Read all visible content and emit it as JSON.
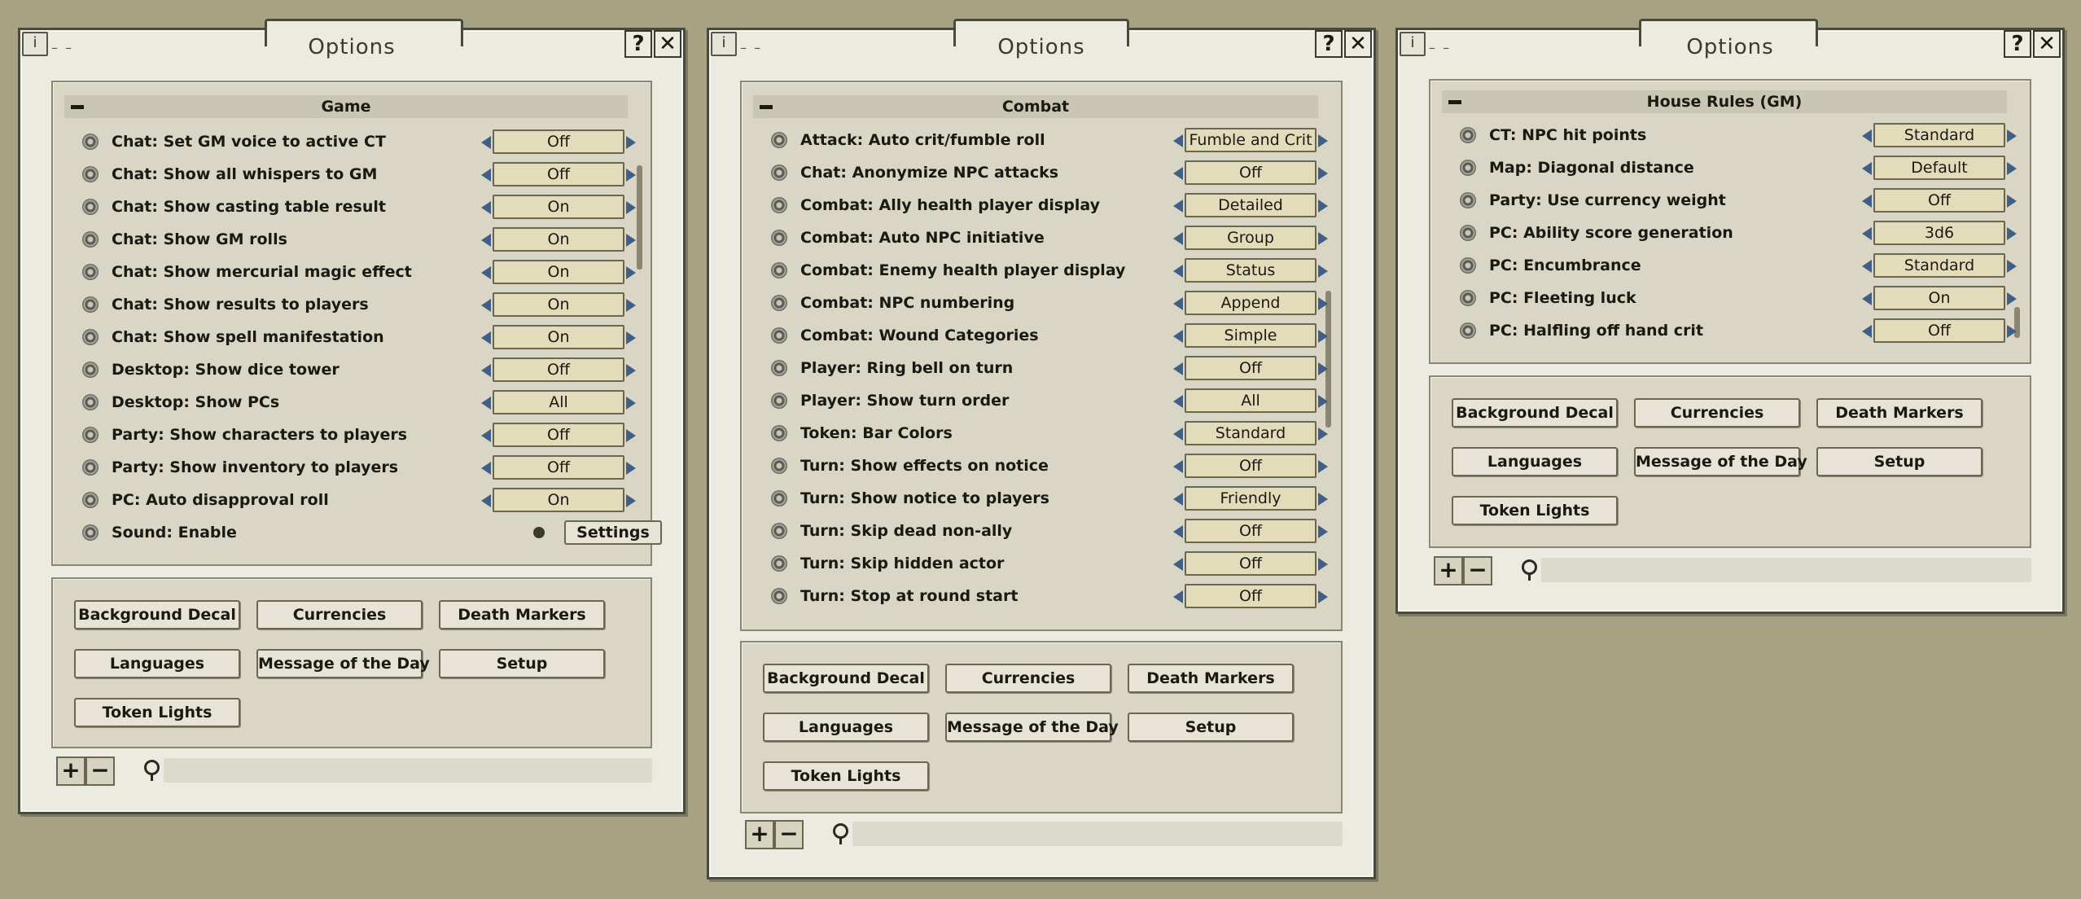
{
  "colors": {
    "background": "#a8a284",
    "arrow": "#3f5f86",
    "value_box": "#e3dcbb"
  },
  "windows": [
    {
      "title": "Options",
      "section": "Game",
      "rows": [
        {
          "label": "Chat: Set GM voice to active CT",
          "value": "Off"
        },
        {
          "label": "Chat: Show all whispers to GM",
          "value": "Off"
        },
        {
          "label": "Chat: Show casting table result",
          "value": "On"
        },
        {
          "label": "Chat: Show GM rolls",
          "value": "On"
        },
        {
          "label": "Chat: Show mercurial magic effect",
          "value": "On"
        },
        {
          "label": "Chat: Show results to players",
          "value": "On"
        },
        {
          "label": "Chat: Show spell manifestation",
          "value": "On"
        },
        {
          "label": "Desktop: Show dice tower",
          "value": "Off"
        },
        {
          "label": "Desktop: Show PCs",
          "value": "All"
        },
        {
          "label": "Party: Show characters to players",
          "value": "Off"
        },
        {
          "label": "Party: Show inventory to players",
          "value": "Off"
        },
        {
          "label": "PC: Auto disapproval roll",
          "value": "On"
        }
      ],
      "sound_row": {
        "label": "Sound: Enable",
        "button": "Settings"
      },
      "buttons": [
        "Background Decal",
        "Currencies",
        "Death Markers",
        "Languages",
        "Message of the Day",
        "Setup",
        "Token Lights"
      ]
    },
    {
      "title": "Options",
      "section": "Combat",
      "rows": [
        {
          "label": "Attack: Auto crit/fumble roll",
          "value": "Fumble and Crit"
        },
        {
          "label": "Chat: Anonymize NPC attacks",
          "value": "Off"
        },
        {
          "label": "Combat: Ally health player display",
          "value": "Detailed"
        },
        {
          "label": "Combat: Auto NPC initiative",
          "value": "Group"
        },
        {
          "label": "Combat: Enemy health player display",
          "value": "Status"
        },
        {
          "label": "Combat: NPC numbering",
          "value": "Append"
        },
        {
          "label": "Combat: Wound Categories",
          "value": "Simple"
        },
        {
          "label": "Player: Ring bell on turn",
          "value": "Off"
        },
        {
          "label": "Player: Show turn order",
          "value": "All"
        },
        {
          "label": "Token: Bar Colors",
          "value": "Standard"
        },
        {
          "label": "Turn: Show effects on notice",
          "value": "Off"
        },
        {
          "label": "Turn: Show notice to players",
          "value": "Friendly"
        },
        {
          "label": "Turn: Skip dead non-ally",
          "value": "Off"
        },
        {
          "label": "Turn: Skip hidden actor",
          "value": "Off"
        },
        {
          "label": "Turn: Stop at round start",
          "value": "Off"
        }
      ],
      "buttons": [
        "Background Decal",
        "Currencies",
        "Death Markers",
        "Languages",
        "Message of the Day",
        "Setup",
        "Token Lights"
      ]
    },
    {
      "title": "Options",
      "section": "House Rules (GM)",
      "rows": [
        {
          "label": "CT: NPC hit points",
          "value": "Standard"
        },
        {
          "label": "Map: Diagonal distance",
          "value": "Default"
        },
        {
          "label": "Party: Use currency weight",
          "value": "Off"
        },
        {
          "label": "PC: Ability score generation",
          "value": "3d6"
        },
        {
          "label": "PC: Encumbrance",
          "value": "Standard"
        },
        {
          "label": "PC: Fleeting luck",
          "value": "On"
        },
        {
          "label": "PC: Halfling off hand crit",
          "value": "Off"
        }
      ],
      "buttons": [
        "Background Decal",
        "Currencies",
        "Death Markers",
        "Languages",
        "Message of the Day",
        "Setup",
        "Token Lights"
      ]
    }
  ],
  "icons": {
    "info": "info-icon",
    "help": "help-icon",
    "close": "close-icon",
    "collapse": "collapse-icon",
    "search": "search-icon",
    "add": "plus-icon",
    "remove": "minus-icon",
    "cycle_left": "arrow-left-icon",
    "cycle_right": "arrow-right-icon"
  },
  "glyphs": {
    "info": "i",
    "help": "?",
    "close": "✕",
    "plus": "+",
    "minus": "−",
    "dashes": "– –"
  }
}
